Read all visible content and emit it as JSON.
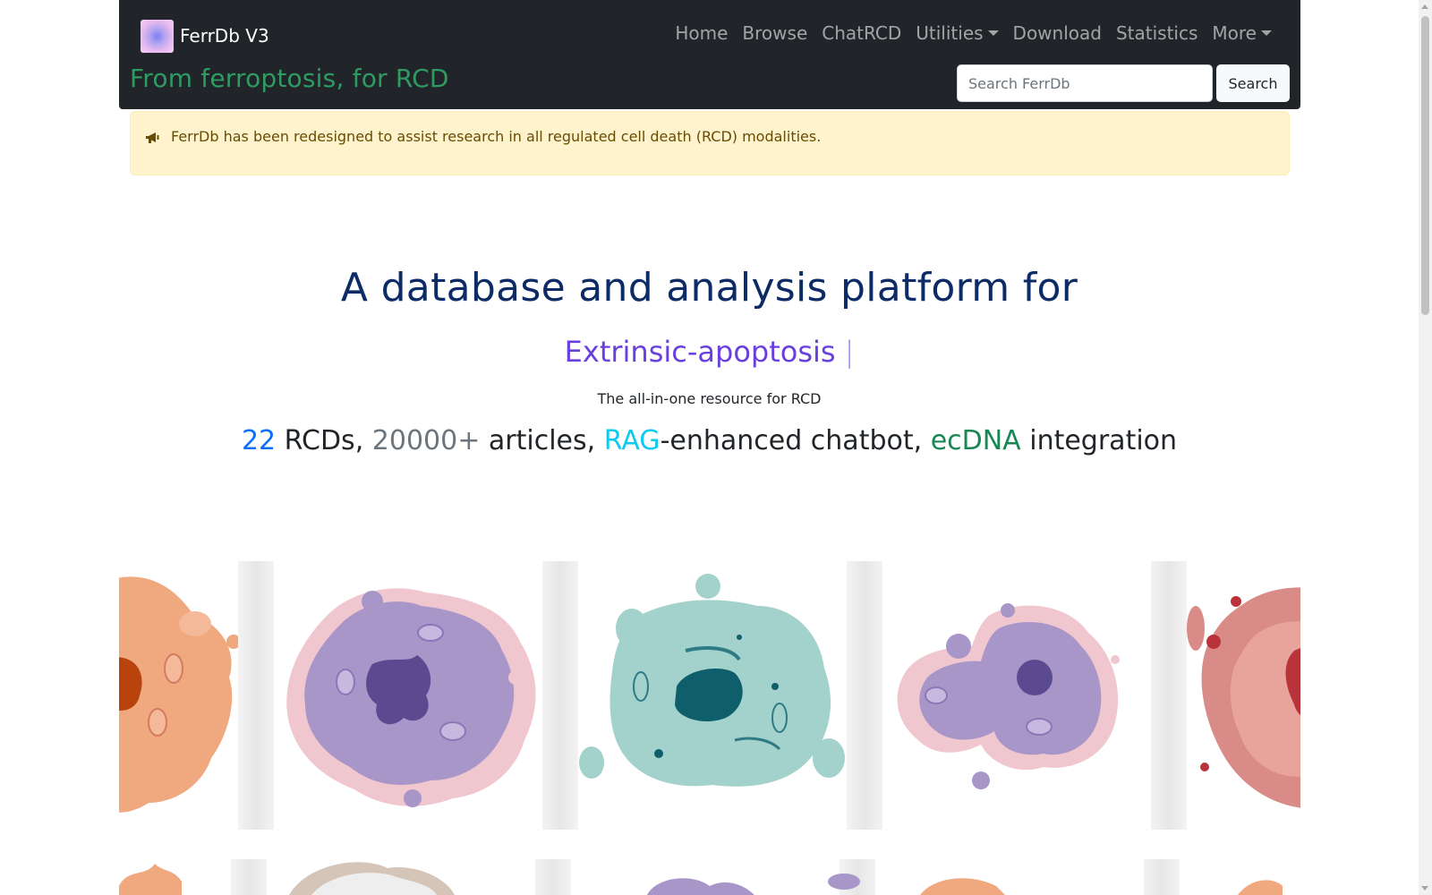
{
  "navbar": {
    "brand": "FerrDb V3",
    "tagline": "From ferroptosis, for RCD",
    "items": [
      {
        "label": "Home",
        "dropdown": false
      },
      {
        "label": "Browse",
        "dropdown": false
      },
      {
        "label": "ChatRCD",
        "dropdown": false
      },
      {
        "label": "Utilities",
        "dropdown": true
      },
      {
        "label": "Download",
        "dropdown": false
      },
      {
        "label": "Statistics",
        "dropdown": false
      },
      {
        "label": "More",
        "dropdown": true
      }
    ],
    "search": {
      "placeholder": "Search FerrDb",
      "value": "",
      "button_label": "Search"
    }
  },
  "alert": {
    "icon": "megaphone-icon",
    "text": "FerrDb has been redesigned to assist research in all regulated cell death (RCD) modalities."
  },
  "hero": {
    "title": "A database and analysis platform for",
    "typed_text": "Extrinsic-apoptosis",
    "cursor": "|",
    "subtitle": "The all-in-one resource for RCD",
    "stats": {
      "rcd_count": "22",
      "rcd_text": " RCDs, ",
      "article_count": "20000+",
      "article_text": " articles, ",
      "rag": "RAG",
      "chatbot_text": "-enhanced chatbot, ",
      "ecdna": "ecDNA",
      "integration_text": " integration"
    }
  },
  "colors": {
    "navbar_bg": "#212529",
    "tagline": "#2e9b63",
    "alert_bg": "#fff3cd",
    "alert_text": "#664d03",
    "hero_title": "#0d2b66",
    "typed": "#6a3fe0",
    "rcd_count": "#0d6efd",
    "article_count": "#6c757d",
    "rag": "#0dcaf0",
    "ecdna": "#198754"
  },
  "carousel": {
    "cards": [
      {
        "name": "orange-cell-illustration"
      },
      {
        "name": "purple-pink-cell-illustration"
      },
      {
        "name": "teal-cell-illustration"
      },
      {
        "name": "purple-dividing-cell-illustration"
      },
      {
        "name": "red-cell-illustration"
      }
    ]
  }
}
